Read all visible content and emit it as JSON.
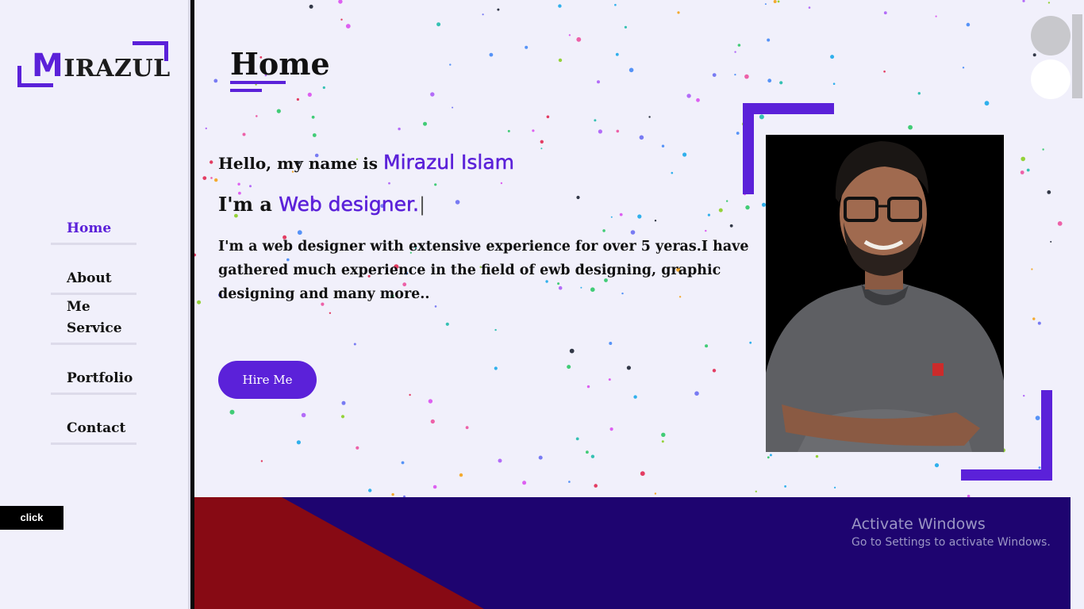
{
  "brand": {
    "logo_first_letter": "M",
    "logo_rest": "IRAZUL"
  },
  "nav": {
    "items": [
      {
        "label": "Home",
        "active": true
      },
      {
        "label": "About Me",
        "active": false
      },
      {
        "label": "Service",
        "active": false
      },
      {
        "label": "Portfolio",
        "active": false
      },
      {
        "label": "Contact",
        "active": false
      }
    ]
  },
  "click_button": "click",
  "home": {
    "title": "Home",
    "greeting_prefix": "Hello, my name is",
    "name": "Mirazul Islam",
    "role_prefix": "I'm a",
    "profession": "Web designer.",
    "cursor": "|",
    "description": "I'm a web designer with extensive experience for over 5 yeras.I have gathered much experience in the field of ewb designing, graphic designing and many more..",
    "hire_button": "Hire Me"
  },
  "os_overlay": {
    "title": "Activate Windows",
    "subtitle": "Go to Settings to activate Windows."
  },
  "colors": {
    "accent": "#5b21d9",
    "background": "#f1f0fb",
    "footer": "#1e0470",
    "footer_red": "#870a14"
  }
}
